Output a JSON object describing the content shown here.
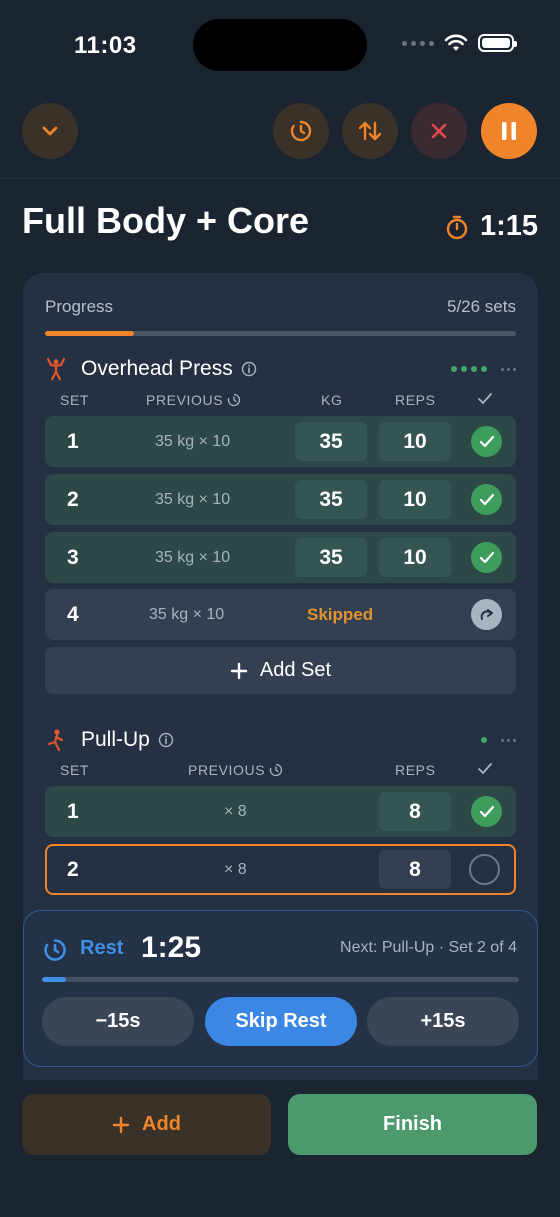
{
  "status_bar": {
    "time": "11:03"
  },
  "colors": {
    "accent": "#f0842a",
    "success": "#3e9c5d",
    "rest_blue": "#3f8fe6",
    "background": "#1b2431",
    "card": "#253142"
  },
  "toolbar": {
    "icons": [
      "chevron-down-icon",
      "timer-icon",
      "reorder-icon",
      "close-icon",
      "pause-icon"
    ]
  },
  "workout": {
    "title": "Full Body + Core",
    "elapsed": "1:15"
  },
  "progress": {
    "label": "Progress",
    "count": "5/26 sets",
    "fraction": 0.19
  },
  "exercises": [
    {
      "name": "Overhead Press",
      "columns": {
        "set": "SET",
        "previous": "PREVIOUS",
        "kg": "KG",
        "reps": "REPS"
      },
      "sets": [
        {
          "num": "1",
          "previous": "35 kg × 10",
          "kg": "35",
          "reps": "10",
          "status": "done"
        },
        {
          "num": "2",
          "previous": "35 kg × 10",
          "kg": "35",
          "reps": "10",
          "status": "done"
        },
        {
          "num": "3",
          "previous": "35 kg × 10",
          "kg": "35",
          "reps": "10",
          "status": "done"
        },
        {
          "num": "4",
          "previous": "35 kg × 10",
          "status_label": "Skipped",
          "status": "skipped"
        }
      ],
      "add_set_label": "Add Set"
    },
    {
      "name": "Pull-Up",
      "columns": {
        "set": "SET",
        "previous": "PREVIOUS",
        "reps": "REPS"
      },
      "sets": [
        {
          "num": "1",
          "previous": "× 8",
          "reps": "8",
          "status": "done"
        },
        {
          "num": "2",
          "previous": "× 8",
          "reps": "8",
          "status": "active"
        }
      ]
    }
  ],
  "rest": {
    "label": "Rest",
    "time": "1:25",
    "next": "Next: Pull-Up · Set 2 of 4",
    "fraction": 0.05,
    "minus_label": "−15s",
    "skip_label": "Skip Rest",
    "plus_label": "+15s"
  },
  "bottom": {
    "add_label": "Add",
    "finish_label": "Finish"
  }
}
